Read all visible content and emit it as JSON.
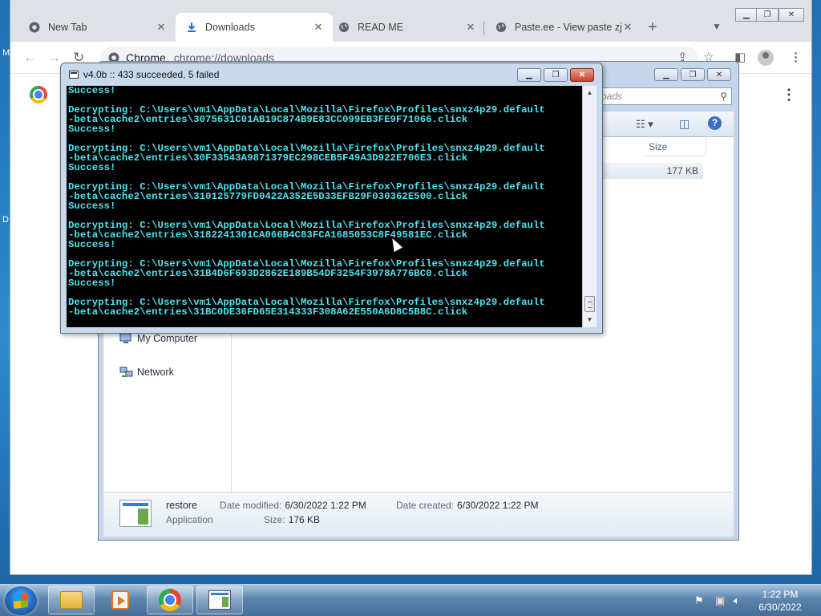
{
  "browser": {
    "tabs": [
      {
        "title": "New Tab",
        "icon": "chrome-icon"
      },
      {
        "title": "Downloads",
        "icon": "download-icon"
      },
      {
        "title": "READ ME",
        "icon": "globe-icon"
      },
      {
        "title": "Paste.ee - View paste zjl",
        "icon": "globe-icon"
      }
    ],
    "address_site": "Chrome",
    "address_url": "chrome://downloads"
  },
  "explorer": {
    "search_placeholder": "oads",
    "column_size": "Size",
    "file_size": "177 KB",
    "nav": [
      "My Computer",
      "Network"
    ],
    "details": {
      "name": "restore",
      "type": "Application",
      "modified_label": "Date modified:",
      "modified_value": "6/30/2022 1:22 PM",
      "created_label": "Date created:",
      "created_value": "6/30/2022 1:22 PM",
      "size_label": "Size:",
      "size_value": "176 KB"
    }
  },
  "console": {
    "title": "v4.0b :: 433 succeeded, 5 failed",
    "lines": [
      "Success!",
      "",
      "Decrypting: C:\\Users\\vm1\\AppData\\Local\\Mozilla\\Firefox\\Profiles\\snxz4p29.default",
      "-beta\\cache2\\entries\\3075631C01AB19C874B9E83CC099EB3FE9F71066.click",
      "Success!",
      "",
      "Decrypting: C:\\Users\\vm1\\AppData\\Local\\Mozilla\\Firefox\\Profiles\\snxz4p29.default",
      "-beta\\cache2\\entries\\30F33543A9871379EC298CEB5F49A3D922E706E3.click",
      "Success!",
      "",
      "Decrypting: C:\\Users\\vm1\\AppData\\Local\\Mozilla\\Firefox\\Profiles\\snxz4p29.default",
      "-beta\\cache2\\entries\\310125779FD0422A352E5D33EFB29F030362E500.click",
      "Success!",
      "",
      "Decrypting: C:\\Users\\vm1\\AppData\\Local\\Mozilla\\Firefox\\Profiles\\snxz4p29.default",
      "-beta\\cache2\\entries\\3182241301CA066B4C83FCA1685053C8F49581EC.click",
      "Success!",
      "",
      "Decrypting: C:\\Users\\vm1\\AppData\\Local\\Mozilla\\Firefox\\Profiles\\snxz4p29.default",
      "-beta\\cache2\\entries\\31B4D6F693D2862E189B54DF3254F3978A776BC0.click",
      "Success!",
      "",
      "Decrypting: C:\\Users\\vm1\\AppData\\Local\\Mozilla\\Firefox\\Profiles\\snxz4p29.default",
      "-beta\\cache2\\entries\\31BC0DE36FD65E314333F308A62E550A6D8C5B8C.click"
    ],
    "text_color": "#4fe3ef"
  },
  "desktop": {
    "edge_fragments": [
      "M",
      "D"
    ]
  },
  "taskbar": {
    "time": "1:22 PM",
    "date": "6/30/2022"
  }
}
